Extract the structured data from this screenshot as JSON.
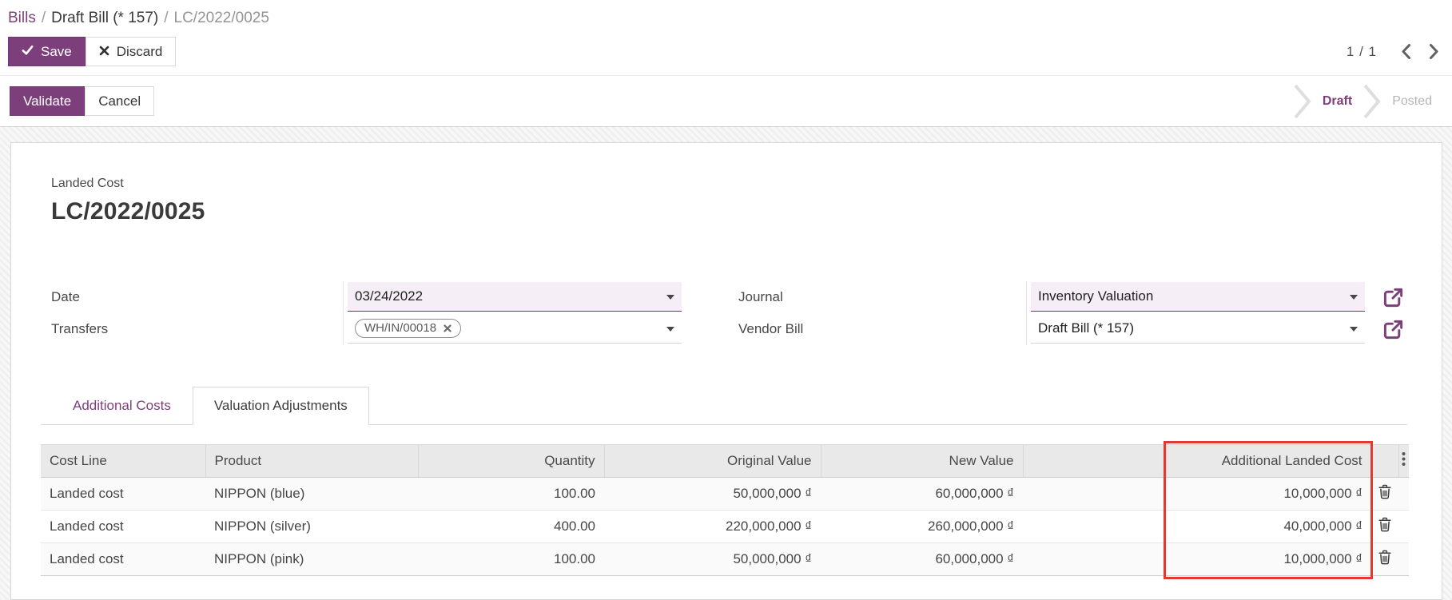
{
  "breadcrumb": {
    "separator": "/",
    "items": [
      {
        "label": "Bills"
      },
      {
        "label": "Draft Bill (* 157)"
      },
      {
        "label": "LC/2022/0025"
      }
    ]
  },
  "toolbar": {
    "save": "Save",
    "discard": "Discard"
  },
  "pager": {
    "text": "1 / 1"
  },
  "statusbar": {
    "validate": "Validate",
    "cancel": "Cancel",
    "active_state": "Draft",
    "states": [
      {
        "label": "Draft"
      },
      {
        "label": "Posted"
      }
    ]
  },
  "sheet": {
    "model_label": "Landed Cost",
    "title": "LC/2022/0025",
    "fields": {
      "date": {
        "label": "Date",
        "value": "03/24/2022"
      },
      "transfers": {
        "label": "Transfers",
        "tags": [
          {
            "label": "WH/IN/00018"
          }
        ]
      },
      "journal": {
        "label": "Journal",
        "value": "Inventory Valuation"
      },
      "vendor_bill": {
        "label": "Vendor Bill",
        "value": "Draft Bill (* 157)"
      }
    },
    "tabs": [
      {
        "label": "Additional Costs"
      },
      {
        "label": "Valuation Adjustments"
      }
    ],
    "active_tab": "Valuation Adjustments"
  },
  "table": {
    "headers": [
      "Cost Line",
      "Product",
      "Quantity",
      "Original Value",
      "New Value",
      "",
      "Additional Landed Cost"
    ],
    "highlighted_column": "Additional Landed Cost",
    "rows": [
      {
        "cost_line": "Landed cost",
        "product": "NIPPON (blue)",
        "quantity": "100.00",
        "original_value": "50,000,000 ₫",
        "new_value": "60,000,000 ₫",
        "additional_landed_cost": "10,000,000 ₫"
      },
      {
        "cost_line": "Landed cost",
        "product": "NIPPON (silver)",
        "quantity": "400.00",
        "original_value": "220,000,000 ₫",
        "new_value": "260,000,000 ₫",
        "additional_landed_cost": "40,000,000 ₫"
      },
      {
        "cost_line": "Landed cost",
        "product": "NIPPON (pink)",
        "quantity": "100.00",
        "original_value": "50,000,000 ₫",
        "new_value": "60,000,000 ₫",
        "additional_landed_cost": "10,000,000 ₫"
      }
    ]
  },
  "colors": {
    "primary": "#7d3f7b",
    "field_highlight": "#f6eef7",
    "annotation_red": "#e4392e"
  }
}
